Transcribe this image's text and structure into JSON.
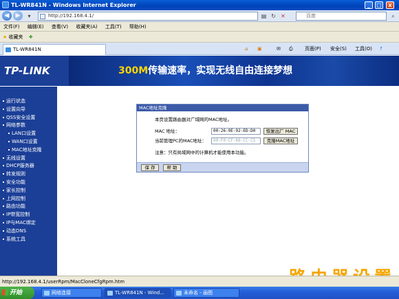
{
  "window": {
    "title": "TL-WR841N - Windows Internet Explorer",
    "minimize": "_",
    "maximize": "□",
    "close": "x"
  },
  "address_bar": {
    "url": "http://192.168.4.1/",
    "search_placeholder": "百度"
  },
  "menu": [
    "文件(F)",
    "编辑(E)",
    "查看(V)",
    "收藏夹(A)",
    "工具(T)",
    "帮助(H)"
  ],
  "favorites_bar": {
    "label": "收藏夹"
  },
  "tab": {
    "title": "TL-WR841N"
  },
  "toolbar_right": {
    "page": "页面(P)",
    "safety": "安全(S)",
    "tools": "工具(O)"
  },
  "banner": {
    "logo": "TP-LINK",
    "slogan_speed": "300M",
    "slogan_text": "传输速率，实现无线自由连接梦想"
  },
  "sidebar": {
    "items": [
      {
        "label": "运行状态",
        "sub": false
      },
      {
        "label": "设置向导",
        "sub": false
      },
      {
        "label": "QSS安全设置",
        "sub": false
      },
      {
        "label": "网络参数",
        "sub": false
      },
      {
        "label": "LAN口设置",
        "sub": true
      },
      {
        "label": "WAN口设置",
        "sub": true
      },
      {
        "label": "MAC地址克隆",
        "sub": true
      },
      {
        "label": "无线设置",
        "sub": false
      },
      {
        "label": "DHCP服务器",
        "sub": false
      },
      {
        "label": "转发规则",
        "sub": false
      },
      {
        "label": "安全功能",
        "sub": false
      },
      {
        "label": "家长控制",
        "sub": false
      },
      {
        "label": "上网控制",
        "sub": false
      },
      {
        "label": "路由功能",
        "sub": false
      },
      {
        "label": "IP带宽控制",
        "sub": false
      },
      {
        "label": "IP与MAC绑定",
        "sub": false
      },
      {
        "label": "动态DNS",
        "sub": false
      },
      {
        "label": "系统工具",
        "sub": false
      }
    ]
  },
  "panel": {
    "title": "MAC地址克隆",
    "intro": "本页设置路由器对广域网的MAC地址。",
    "mac_label": "MAC 地址：",
    "mac_value": "00-26-9E-92-ED-D0",
    "restore_button": "恢复出厂 MAC",
    "pc_mac_label": "当前管理PC的MAC地址：",
    "pc_mac_value": "00-F0-CF-66-CC-C5",
    "clone_button": "克隆MAC地址",
    "note": "注意：只有局域网中的计算机才能使用本功能。",
    "save_button": "保 存",
    "help_button": "帮 助"
  },
  "statusbar": {
    "text": "http://192.168.4.1/userRpm/MacCloneCfgRpm.htm"
  },
  "taskbar": {
    "start": "开始",
    "items": [
      "网络连接",
      "TL-WR841N - Wind...",
      "未命名 - 画图"
    ]
  },
  "watermark": "路由器设置"
}
